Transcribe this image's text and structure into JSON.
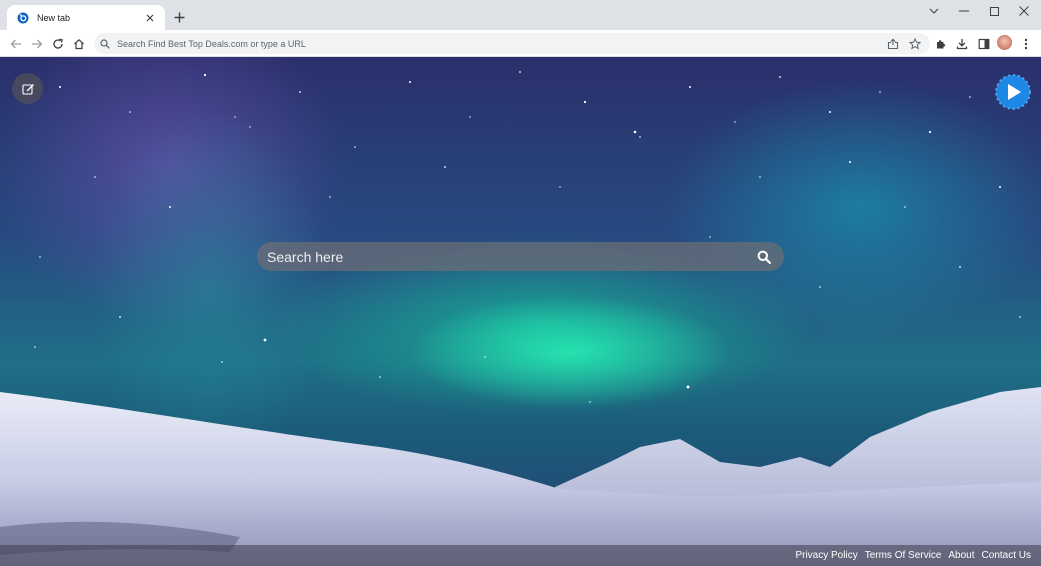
{
  "browser": {
    "tab": {
      "title": "New tab",
      "favicon": "search-brand-icon"
    },
    "omnibox": {
      "placeholder": "Search Find Best Top Deals.com or type a URL"
    }
  },
  "page": {
    "search": {
      "placeholder": "Search here",
      "icon": "search-icon"
    },
    "footer_links": [
      {
        "label": "Privacy Policy"
      },
      {
        "label": "Terms Of Service"
      },
      {
        "label": "About"
      },
      {
        "label": "Contact Us"
      }
    ]
  },
  "colors": {
    "accent_blue": "#1a73e8",
    "play_button": "#1e88e5"
  }
}
